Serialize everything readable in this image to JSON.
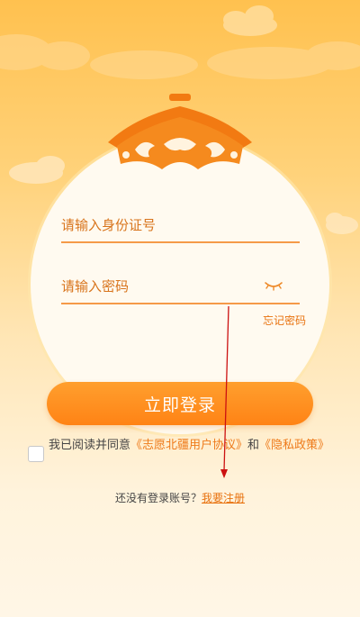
{
  "login_form": {
    "id_placeholder": "请输入身份证号",
    "password_placeholder": "请输入密码",
    "forgot_password": "忘记密码",
    "login_button": "立即登录"
  },
  "agreement": {
    "prefix": "我已阅读并同意",
    "user_agreement": "《志愿北疆用户协议》",
    "conjunction": "和",
    "privacy_policy": "《隐私政策》",
    "checked": false
  },
  "register": {
    "prompt": "还没有登录账号？",
    "link": "我要注册"
  },
  "icons": {
    "password_toggle": "eye-closed-icon",
    "checkbox": "checkbox-icon"
  },
  "colors": {
    "accent": "#ff8a1f",
    "link": "#e8720f",
    "background_top": "#ffc14f",
    "background_bottom": "#fff6e6"
  }
}
